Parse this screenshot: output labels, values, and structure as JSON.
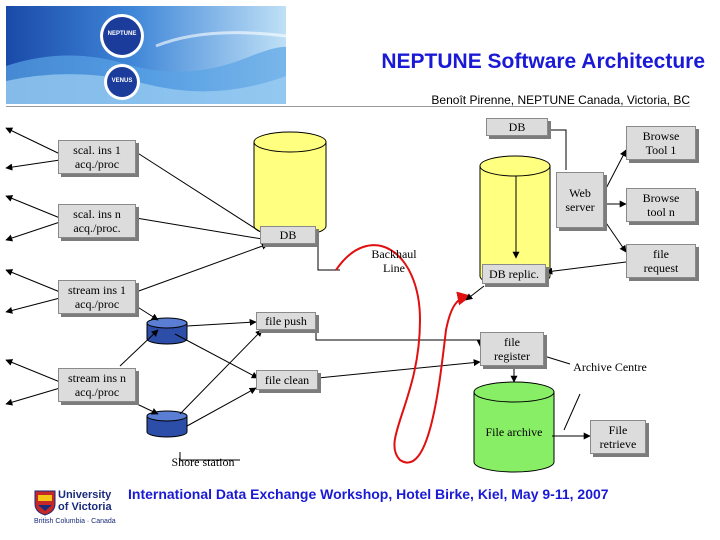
{
  "header": {
    "title": "NEPTUNE Software Architecture",
    "author": "Benoît Pirenne, NEPTUNE Canada, Victoria, BC"
  },
  "banner": {
    "logo_top": "NEPTUNE",
    "logo_bottom": "VENUS"
  },
  "diagram": {
    "instruments": {
      "scal_1": "scal. ins 1\nacq./proc",
      "scal_n": "scal. ins n\nacq./proc.",
      "stream_1": "stream ins 1\nacq./proc",
      "stream_n": "stream ins n\nacq./proc"
    },
    "shore": {
      "db": "DB",
      "file_push": "file push",
      "file_clean": "file clean",
      "station_label": "Shore station"
    },
    "backhaul": "Backhaul\nLine",
    "archive": {
      "db": "DB",
      "db_replic": "DB replic.",
      "web_server": "Web\nserver",
      "browse_tool_1": "Browse\nTool 1",
      "browse_tool_n": "Browse\ntool n",
      "file_request": "file\nrequest",
      "file_register": "file\nregister",
      "centre_label": "Archive Centre",
      "file_archive": "File archive",
      "file_retrieve": "File\nretrieve"
    }
  },
  "footer": {
    "text": "International Data Exchange Workshop, Hotel Birke, Kiel, May 9-11, 2007",
    "uvic_name": "University\nof Victoria",
    "uvic_sub": "British Columbia · Canada"
  },
  "colors": {
    "title": "#1a1ad6",
    "cylinder_fill": "#ffff80",
    "archive_fill": "#88ee66",
    "backhaul": "#e01010",
    "box_fill": "#dcdcdc"
  }
}
